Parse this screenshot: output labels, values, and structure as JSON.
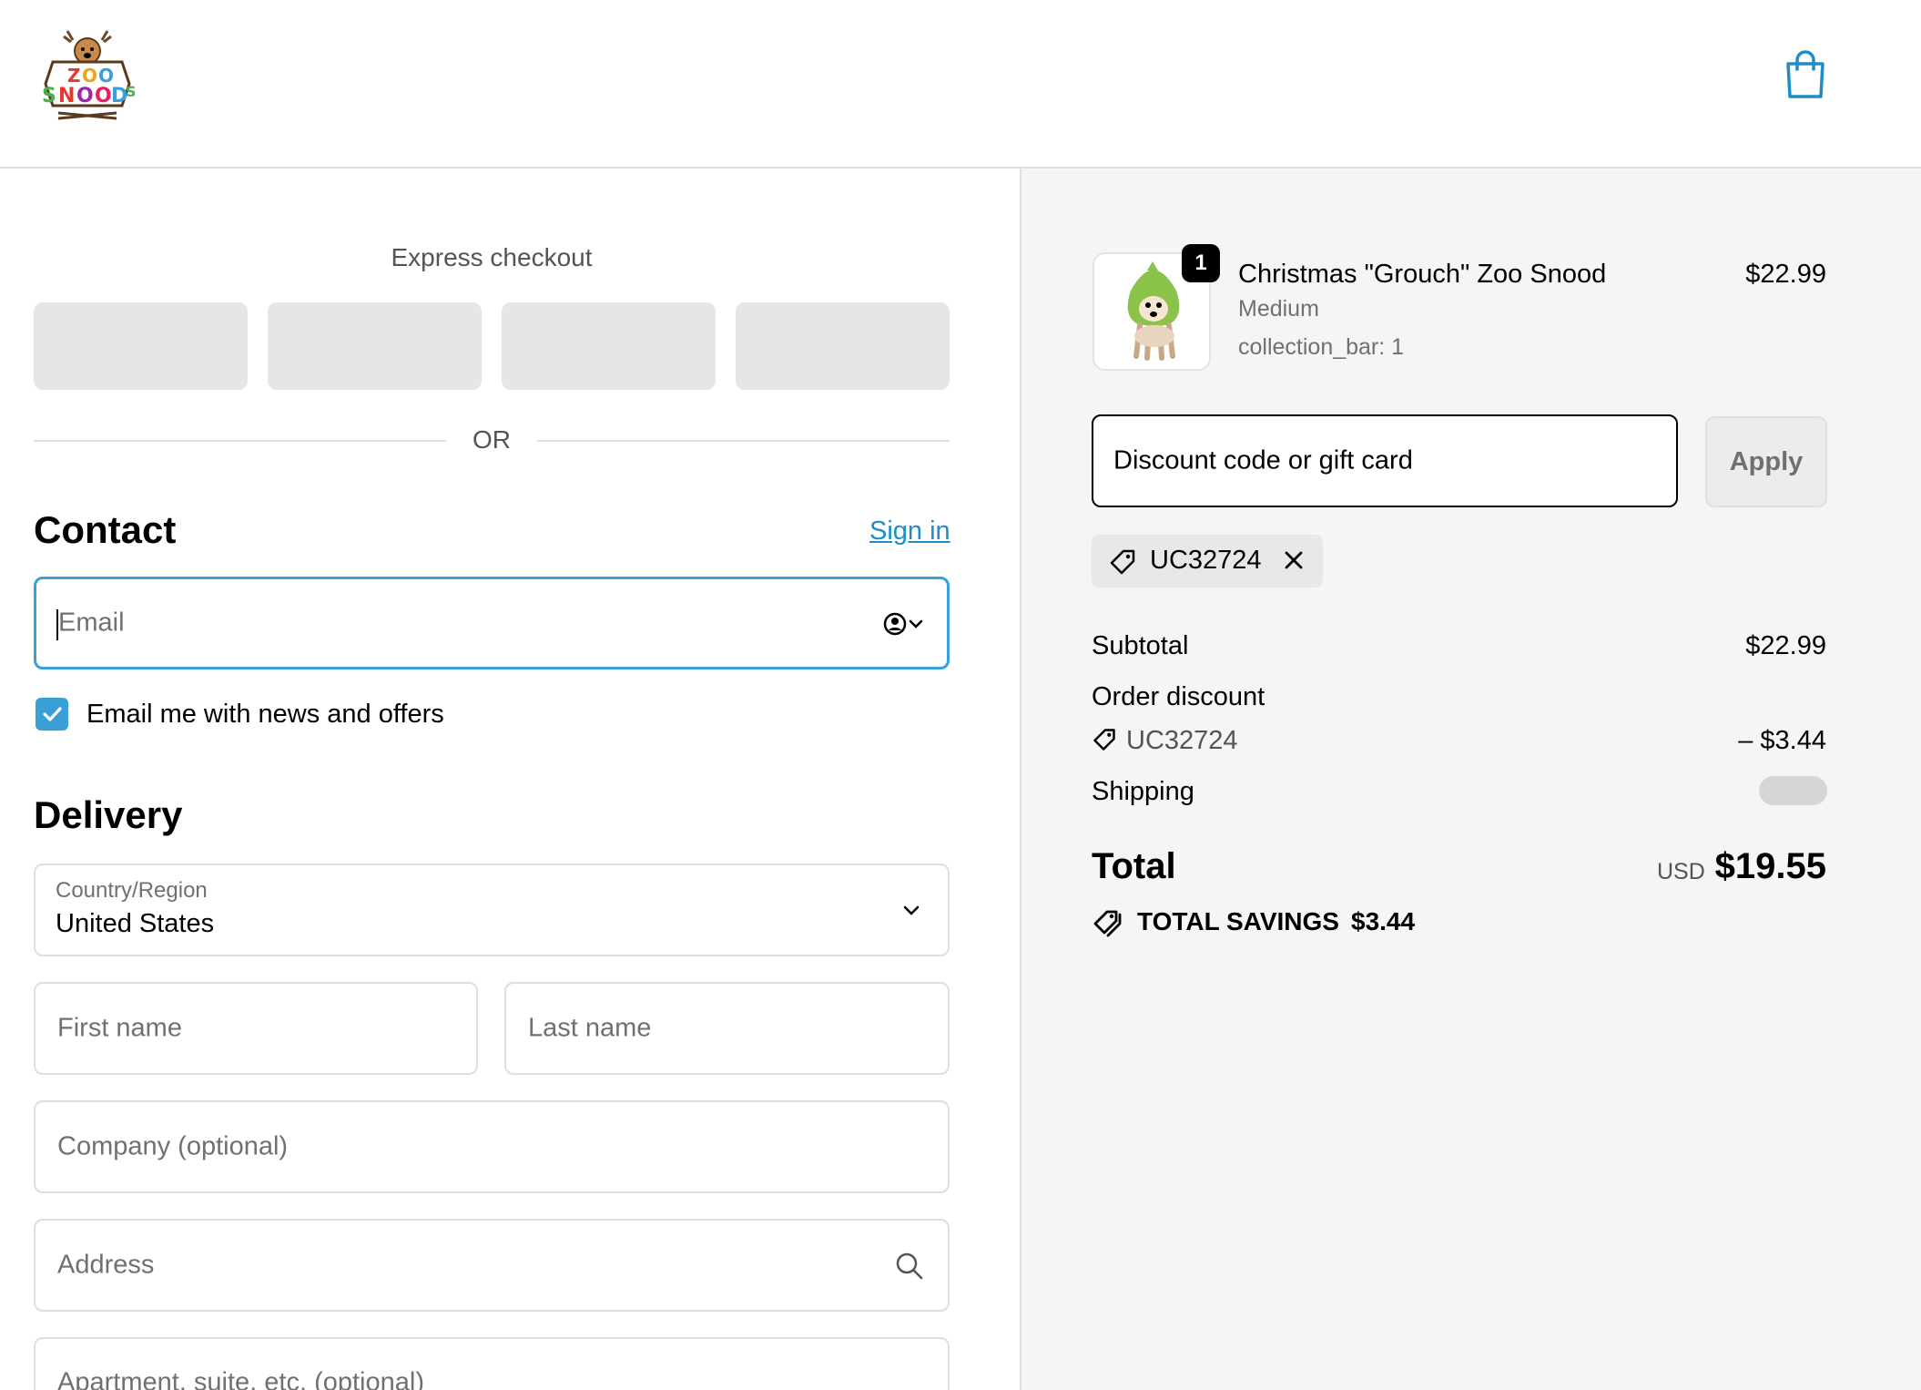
{
  "header": {
    "logo_text": "ZOO SNOODS",
    "cart_icon": "shopping-bag-icon",
    "accent_color": "#1f8ec7"
  },
  "express": {
    "title": "Express checkout",
    "or_label": "OR"
  },
  "contact": {
    "title": "Contact",
    "sign_in_label": "Sign in",
    "email_placeholder": "Email",
    "newsletter_label": "Email me with news and offers",
    "newsletter_checked": true
  },
  "delivery": {
    "title": "Delivery",
    "country_label": "Country/Region",
    "country_value": "United States",
    "first_name_placeholder": "First name",
    "last_name_placeholder": "Last name",
    "company_placeholder": "Company (optional)",
    "address_placeholder": "Address",
    "apartment_placeholder": "Apartment, suite, etc. (optional)"
  },
  "order": {
    "item": {
      "name": "Christmas \"Grouch\" Zoo Snood",
      "variant": "Medium",
      "property": "collection_bar: 1",
      "price": "$22.99",
      "quantity": "1"
    },
    "discount_placeholder": "Discount code or gift card",
    "apply_label": "Apply",
    "applied_code": "UC32724",
    "subtotal_label": "Subtotal",
    "subtotal_value": "$22.99",
    "discount_label": "Order discount",
    "discount_code": "UC32724",
    "discount_value": "– $3.44",
    "shipping_label": "Shipping",
    "total_label": "Total",
    "total_currency": "USD",
    "total_value": "$19.55",
    "savings_label": "TOTAL SAVINGS",
    "savings_value": "$3.44"
  }
}
